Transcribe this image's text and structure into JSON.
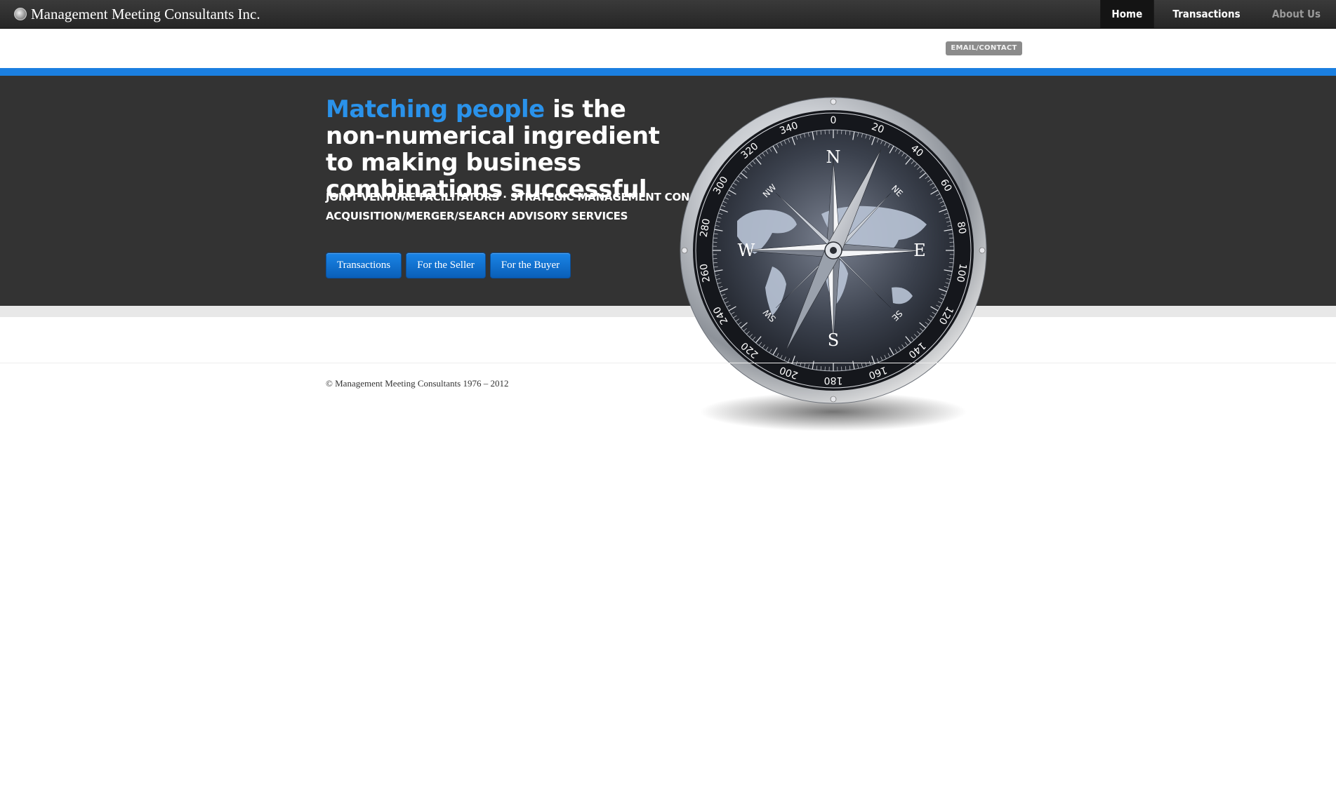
{
  "brand": {
    "name": "Management Meeting Consultants Inc."
  },
  "nav": {
    "items": [
      {
        "label": "Home"
      },
      {
        "label": "Transactions"
      },
      {
        "label": "About Us"
      }
    ]
  },
  "contact": {
    "label": "EMAIL/CONTACT"
  },
  "hero": {
    "headline_accent": "Matching people",
    "headline_rest": " is the non-numerical ingredient to making business combinations successful",
    "subline_1": "JOINT VENTURE FACILITATORS · STRATEGIC MANAGEMENT CONSULTING",
    "subline_2": "ACQUISITION/MERGER/SEARCH ADVISORY SERVICES",
    "buttons": [
      {
        "label": "Transactions"
      },
      {
        "label": "For the Seller"
      },
      {
        "label": "For the Buyer"
      }
    ]
  },
  "compass": {
    "cardinals": [
      "N",
      "E",
      "S",
      "W"
    ],
    "intercardinals": [
      "NE",
      "SE",
      "SW",
      "NW"
    ],
    "degree_labels": [
      "0",
      "20",
      "40",
      "60",
      "80",
      "100",
      "120",
      "140",
      "160",
      "180",
      "200",
      "220",
      "240",
      "260",
      "280",
      "300",
      "320",
      "340"
    ]
  },
  "footer": {
    "copyright": "© Management Meeting Consultants 1976 – 2012"
  },
  "colors": {
    "accent": "#2a92ea",
    "bar": "#1b7fe0",
    "hero_bg": "#333333"
  }
}
